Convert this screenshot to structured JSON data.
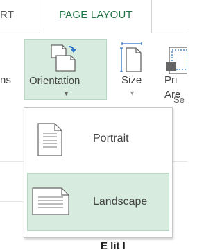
{
  "tabs": {
    "previous_partial": "RT",
    "active": "PAGE LAYOUT"
  },
  "ribbon": {
    "left_partial": "ns",
    "orientation_label": "Orientation",
    "size_label": "Size",
    "print_area_line1": "Pri",
    "print_area_line2": "Are",
    "group_partial": "Se"
  },
  "orientation_menu": {
    "items": [
      {
        "label": "Portrait",
        "selected": false
      },
      {
        "label": "Landscape",
        "selected": true
      }
    ]
  },
  "document": {
    "partial_text": "E lit l"
  },
  "colors": {
    "accent": "#217346",
    "highlight": "#d7ebdf",
    "highlight_border": "#b6d9c3"
  }
}
